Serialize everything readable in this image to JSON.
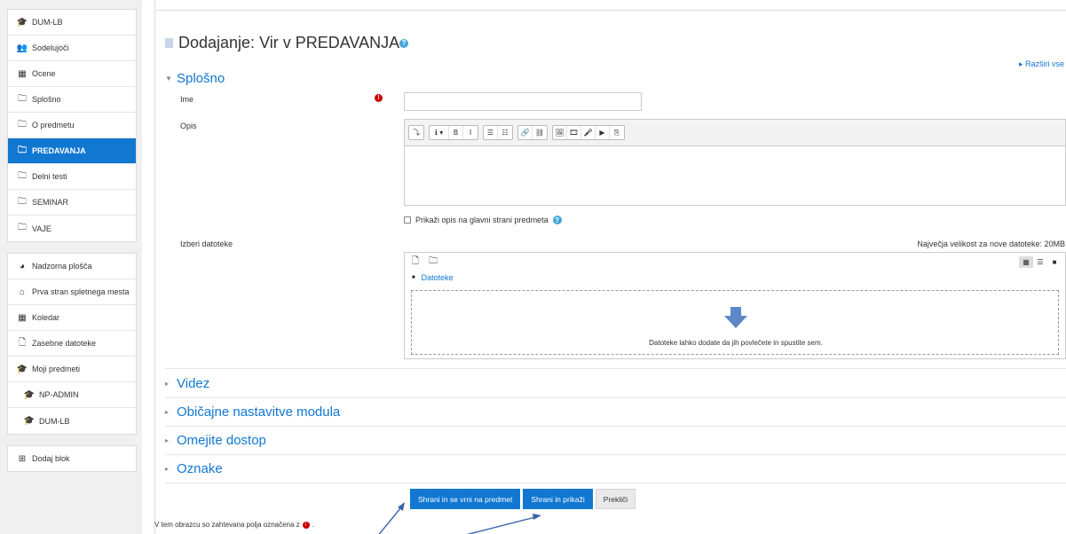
{
  "sidebar": {
    "course_nav": [
      {
        "icon": "graduation-cap-icon",
        "glyph": "🎓",
        "label": "DUM-LB"
      },
      {
        "icon": "users-icon",
        "glyph": "👥",
        "label": "Sodelujoči"
      },
      {
        "icon": "grades-table-icon",
        "glyph": "▦",
        "label": "Ocene"
      },
      {
        "icon": "folder-icon",
        "glyph": "🗀",
        "label": "Splošno"
      },
      {
        "icon": "folder-icon",
        "glyph": "🗀",
        "label": "O predmetu"
      },
      {
        "icon": "folder-icon",
        "glyph": "🗀",
        "label": "PREDAVANJA",
        "active": true
      },
      {
        "icon": "folder-icon",
        "glyph": "🗀",
        "label": "Delni testi"
      },
      {
        "icon": "folder-icon",
        "glyph": "🗀",
        "label": "SEMINAR"
      },
      {
        "icon": "folder-icon",
        "glyph": "🗀",
        "label": "VAJE"
      }
    ],
    "site_nav": [
      {
        "icon": "dashboard-icon",
        "glyph": "◕",
        "label": "Nadzorna plošča"
      },
      {
        "icon": "home-icon",
        "glyph": "⌂",
        "label": "Prva stran spletnega mesta"
      },
      {
        "icon": "calendar-icon",
        "glyph": "▦",
        "label": "Koledar"
      },
      {
        "icon": "file-icon",
        "glyph": "🗋",
        "label": "Zasebne datoteke"
      },
      {
        "icon": "graduation-cap-icon",
        "glyph": "🎓",
        "label": "Moji predmeti"
      },
      {
        "icon": "graduation-cap-icon",
        "glyph": "🎓",
        "label": "NP-ADMIN",
        "indent": true
      },
      {
        "icon": "graduation-cap-icon",
        "glyph": "🎓",
        "label": "DUM-LB",
        "indent": true
      }
    ],
    "add_block": {
      "icon": "plus-square-icon",
      "glyph": "⊞",
      "label": "Dodaj blok"
    }
  },
  "page": {
    "title": "Dodajanje: Vir v PREDAVANJA",
    "expand_all": "Razširi vse"
  },
  "form": {
    "general_section": "Splošno",
    "name_label": "Ime",
    "name_value": "",
    "description_label": "Opis",
    "show_description_label": "Prikaži opis na glavni strani predmeta",
    "files_label": "Izberi datoteke",
    "max_size": "Največja velikost za nove datoteke: 20MB",
    "files_path": "Datoteke",
    "dropzone_text": "Datoteke lahko dodate da jih povlečete in spustite sem."
  },
  "editor_toolbar": [
    [
      "⤵"
    ],
    [
      "ℹ ▾",
      "B",
      "I"
    ],
    [
      "☰",
      "☷"
    ],
    [
      "🔗",
      "⛓"
    ],
    [
      "🖼",
      "🎞",
      "🎤",
      "▶",
      "⎘"
    ]
  ],
  "collapsed_sections": [
    "Videz",
    "Običajne nastavitve modula",
    "Omejite dostop",
    "Oznake"
  ],
  "buttons": {
    "save_return": "Shrani in se vrni na predmet",
    "save_display": "Shrani in prikaži",
    "cancel": "Prekliči"
  },
  "footer": {
    "required_note_prefix": "V tem obrazcu so zahtevana polja označena z",
    "required_note_suffix": "."
  },
  "colors": {
    "accent": "#1177d1",
    "required": "#cc0000",
    "sidebar_bg": "#f0f0f0"
  }
}
